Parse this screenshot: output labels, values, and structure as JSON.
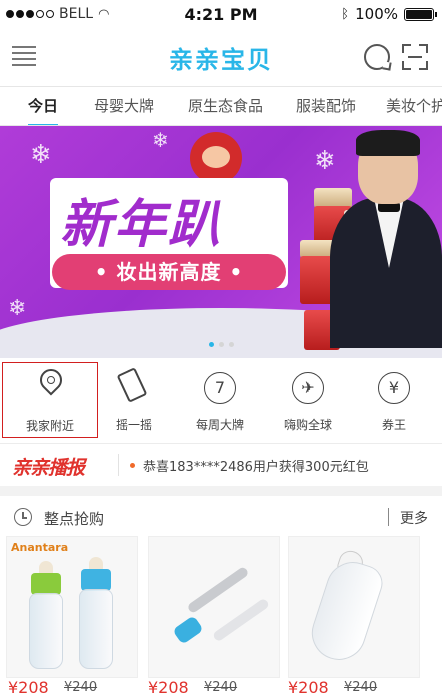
{
  "status_bar": {
    "carrier": "BELL",
    "time": "4:21 PM",
    "battery": "100%"
  },
  "header": {
    "title": "亲亲宝贝"
  },
  "tabs": [
    {
      "label": "今日",
      "active": true
    },
    {
      "label": "母婴大牌",
      "active": false
    },
    {
      "label": "原生态食品",
      "active": false
    },
    {
      "label": "服装配饰",
      "active": false
    },
    {
      "label": "美妆个护",
      "active": false
    }
  ],
  "banner": {
    "headline": "新年趴",
    "tagline": "• 妆出新高度 •",
    "slides": 3,
    "active_slide": 0
  },
  "quick_nav": [
    {
      "label": "我家附近",
      "icon": "location-pin-icon",
      "glyph": "",
      "selected": true
    },
    {
      "label": "摇一摇",
      "icon": "shake-phone-icon",
      "glyph": "",
      "selected": false
    },
    {
      "label": "每周大牌",
      "icon": "number-seven-icon",
      "glyph": "7",
      "selected": false
    },
    {
      "label": "嗨购全球",
      "icon": "airplane-icon",
      "glyph": "✈",
      "selected": false
    },
    {
      "label": "券王",
      "icon": "yen-coupon-icon",
      "glyph": "¥",
      "selected": false
    }
  ],
  "ticker": {
    "logo": "亲亲播报",
    "message": "恭喜183****2486用户获得300元红包"
  },
  "flash_sale": {
    "title": "整点抢购",
    "more": "更多",
    "products": [
      {
        "brand": "Anantara",
        "price": "¥208",
        "old_price": "¥240"
      },
      {
        "brand": "",
        "price": "¥208",
        "old_price": "¥240"
      },
      {
        "brand": "",
        "price": "¥208",
        "old_price": "¥240"
      }
    ]
  },
  "colors": {
    "accent": "#29b6e8",
    "price": "#e0322d",
    "banner": "#a12ccc"
  }
}
